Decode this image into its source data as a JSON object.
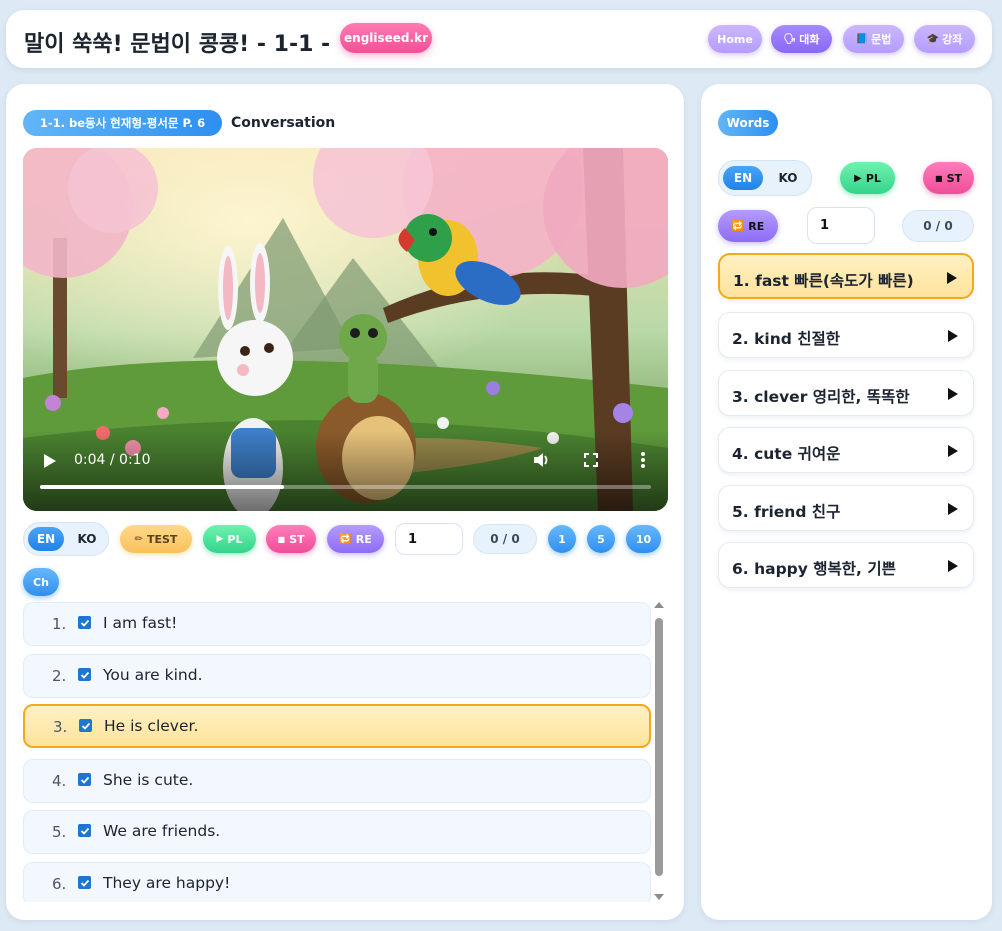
{
  "header": {
    "title": "말이 쑥쑥! 문법이 콩콩! - 1-1 -",
    "brand": "engliseed.kr",
    "nav": {
      "home": "Home",
      "talk": "대화",
      "grammar": "문법",
      "lecture": "강좌"
    }
  },
  "lesson": {
    "badge": "1-1. be동사 현재형-평서문 P. 6",
    "section": "Conversation"
  },
  "video": {
    "time": "0:04 / 0:10",
    "progress": 0.4
  },
  "controls": {
    "en": "EN",
    "ko": "KO",
    "test": "TEST",
    "pl": "PL",
    "st": "ST",
    "re": "RE",
    "repeat_value": "1",
    "counter": "0 / 0",
    "speed_1": "1",
    "speed_5": "5",
    "speed_10": "10",
    "ch": "Ch"
  },
  "sentences": [
    {
      "num": "1.",
      "text": "I am fast!",
      "checked": true,
      "active": false
    },
    {
      "num": "2.",
      "text": "You are kind.",
      "checked": true,
      "active": false
    },
    {
      "num": "3.",
      "text": "He is clever.",
      "checked": true,
      "active": true
    },
    {
      "num": "4.",
      "text": "She is cute.",
      "checked": true,
      "active": false
    },
    {
      "num": "5.",
      "text": "We are friends.",
      "checked": true,
      "active": false
    },
    {
      "num": "6.",
      "text": "They are happy!",
      "checked": true,
      "active": false
    }
  ],
  "words_panel": {
    "title": "Words",
    "en": "EN",
    "ko": "KO",
    "pl": "PL",
    "st": "ST",
    "re": "RE",
    "repeat_value": "1",
    "counter": "0 / 0",
    "words": [
      {
        "label": "1. fast 빠른(속도가 빠른)",
        "active": true
      },
      {
        "label": "2. kind 친절한",
        "active": false
      },
      {
        "label": "3. clever 영리한, 똑똑한",
        "active": false
      },
      {
        "label": "4. cute 귀여운",
        "active": false
      },
      {
        "label": "5. friend 친구",
        "active": false
      },
      {
        "label": "6. happy 행복한, 기쁜",
        "active": false
      }
    ]
  },
  "colors": {
    "accent_blue": "#2e8ff0",
    "highlight": "#ffe39b",
    "highlight_border": "#f4a81c"
  }
}
